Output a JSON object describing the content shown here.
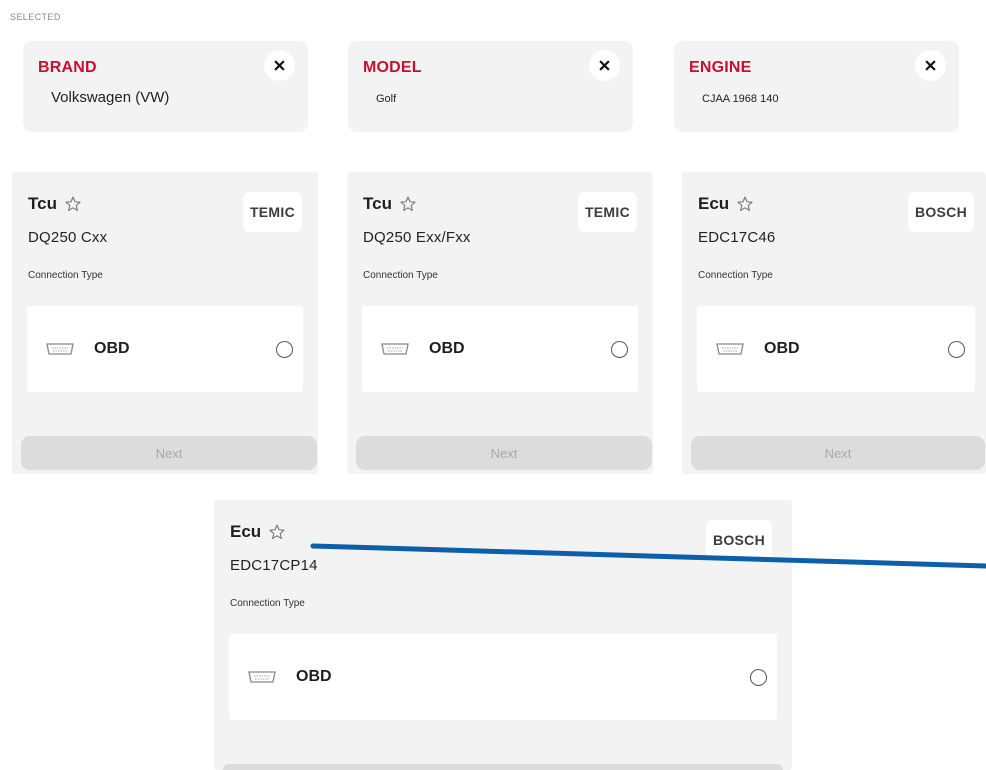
{
  "section_label": "SELECTED",
  "selected": [
    {
      "title": "BRAND",
      "value": "Volkswagen (VW)"
    },
    {
      "title": "MODEL",
      "value": "Golf"
    },
    {
      "title": "ENGINE",
      "value": "CJAA 1968 140"
    }
  ],
  "cards": [
    {
      "type": "Tcu",
      "model": "DQ250 Cxx",
      "brand": "TEMIC",
      "connection_label": "Connection Type",
      "option": "OBD",
      "next": "Next",
      "icons": {
        "favorite": "star-outline-icon",
        "port": "obd-port-icon"
      }
    },
    {
      "type": "Tcu",
      "model": "DQ250 Exx/Fxx",
      "brand": "TEMIC",
      "connection_label": "Connection Type",
      "option": "OBD",
      "next": "Next",
      "icons": {
        "favorite": "star-outline-icon",
        "port": "obd-port-icon"
      }
    },
    {
      "type": "Ecu",
      "model": "EDC17C46",
      "brand": "BOSCH",
      "connection_label": "Connection Type",
      "option": "OBD",
      "next": "Next",
      "icons": {
        "favorite": "star-outline-icon",
        "port": "obd-port-icon"
      }
    },
    {
      "type": "Ecu",
      "model": "EDC17CP14",
      "brand": "BOSCH",
      "connection_label": "Connection Type",
      "option": "OBD",
      "icons": {
        "favorite": "star-outline-icon",
        "port": "obd-port-icon"
      }
    }
  ],
  "colors": {
    "accent": "#c8102e",
    "annotation_line": "#0b5fab"
  }
}
